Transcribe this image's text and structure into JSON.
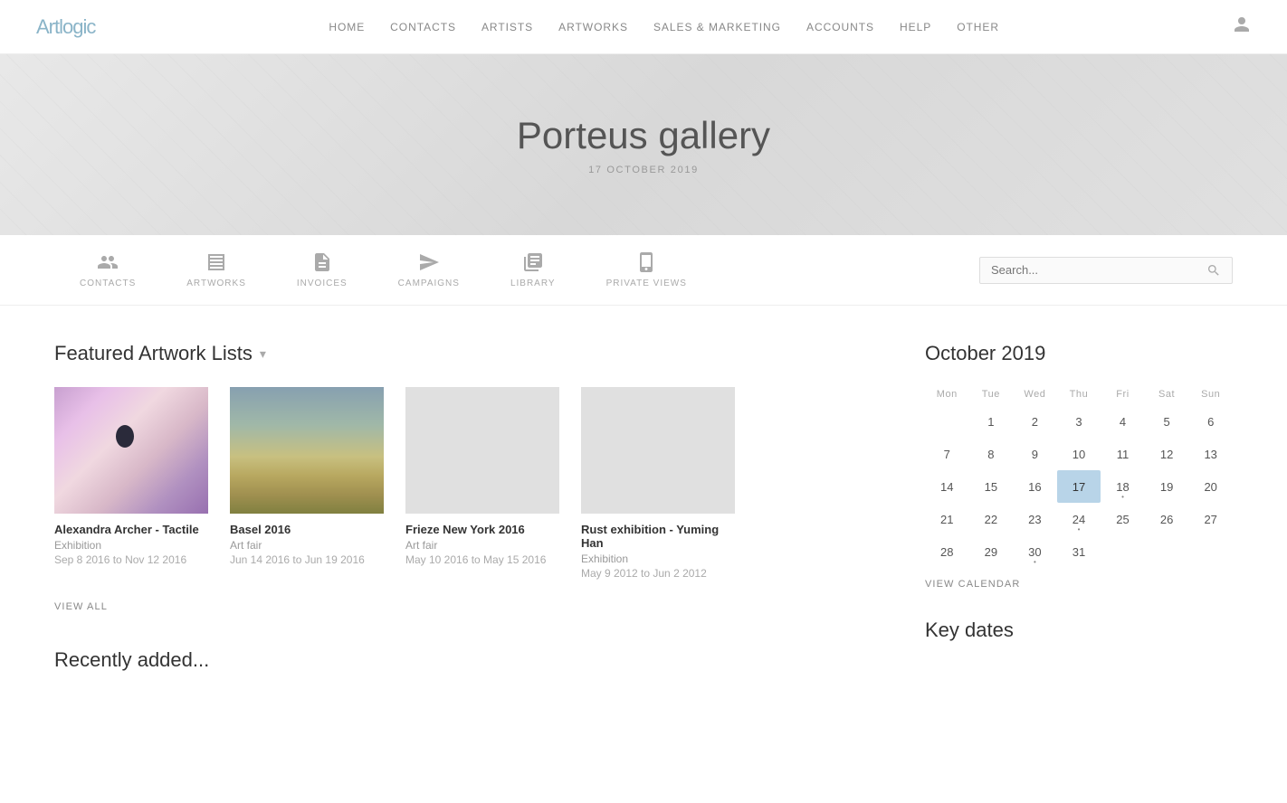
{
  "nav": {
    "logo": "Artlogic",
    "links": [
      "HOME",
      "CONTACTS",
      "ARTISTS",
      "ARTWORKS",
      "SALES & MARKETING",
      "ACCOUNTS",
      "HELP",
      "OTHER"
    ]
  },
  "hero": {
    "title": "Porteus gallery",
    "date": "17 OCTOBER 2019"
  },
  "icon_nav": {
    "items": [
      {
        "id": "contacts",
        "label": "CONTACTS"
      },
      {
        "id": "artworks",
        "label": "ARTWORKS"
      },
      {
        "id": "invoices",
        "label": "INVOICES"
      },
      {
        "id": "campaigns",
        "label": "CAMPAIGNS"
      },
      {
        "id": "library",
        "label": "LIBRARY"
      },
      {
        "id": "privateviews",
        "label": "PRIVATE VIEWS"
      }
    ],
    "search_placeholder": "Search..."
  },
  "featured_section": {
    "title": "Featured Artwork Lists",
    "dropdown_label": "▾",
    "artworks": [
      {
        "name": "Alexandra Archer - Tactile",
        "type": "Exhibition",
        "date": "Sep 8 2016 to Nov 12 2016",
        "thumb_class": "thumb-abstract"
      },
      {
        "name": "Basel 2016",
        "type": "Art fair",
        "date": "Jun 14 2016 to Jun 19 2016",
        "thumb_class": "thumb-road"
      },
      {
        "name": "Frieze New York 2016",
        "type": "Art fair",
        "date": "May 10 2016 to May 15 2016",
        "thumb_class": ""
      },
      {
        "name": "Rust exhibition - Yuming Han",
        "type": "Exhibition",
        "date": "May 9 2012 to Jun 2 2012",
        "thumb_class": ""
      }
    ],
    "view_all_label": "VIEW ALL"
  },
  "calendar": {
    "title": "October 2019",
    "days": [
      "Mon",
      "Tue",
      "Wed",
      "Thu",
      "Fri",
      "Sat",
      "Sun"
    ],
    "weeks": [
      [
        null,
        1,
        2,
        3,
        4,
        5,
        6
      ],
      [
        7,
        8,
        9,
        10,
        11,
        12,
        13
      ],
      [
        14,
        15,
        16,
        17,
        18,
        19,
        20
      ],
      [
        21,
        22,
        23,
        24,
        25,
        26,
        27
      ],
      [
        28,
        29,
        30,
        31,
        null,
        null,
        null
      ]
    ],
    "today": 17,
    "dots": [
      18,
      24,
      30
    ],
    "view_calendar_label": "VIEW CALENDAR"
  },
  "key_dates": {
    "title": "Key dates"
  },
  "recently_added": {
    "title": "Recently added..."
  }
}
